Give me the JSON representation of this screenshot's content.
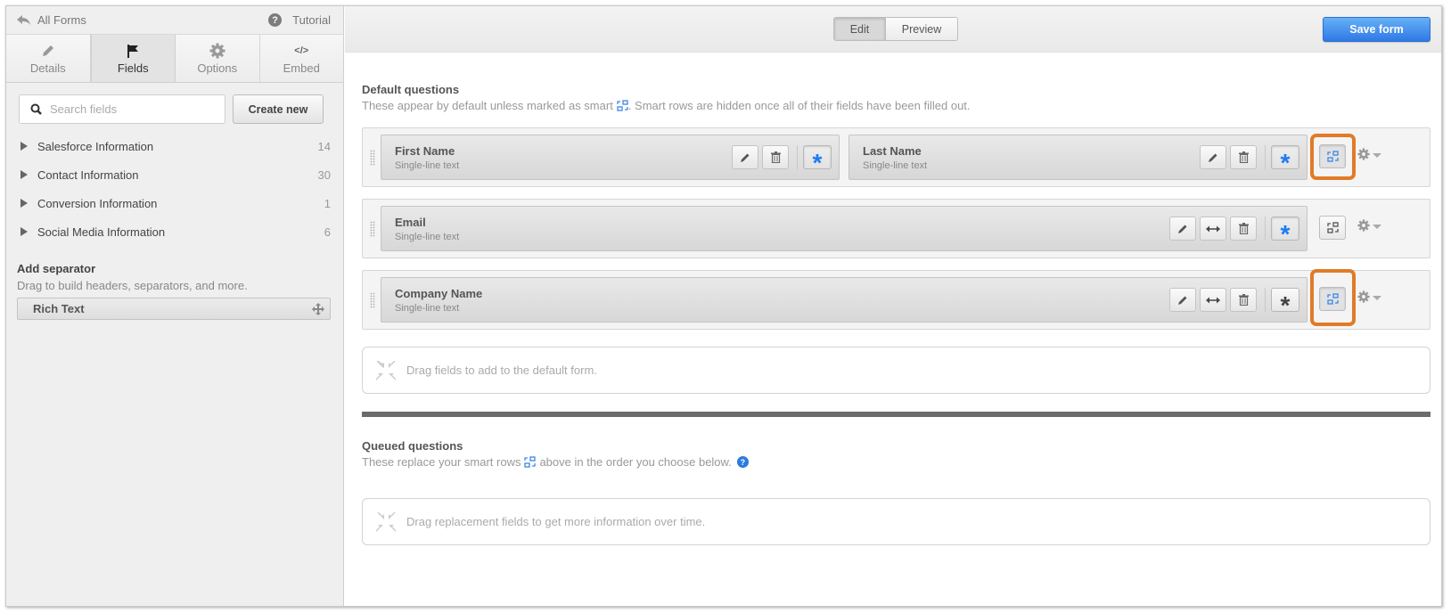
{
  "sidebar": {
    "back_label": "All Forms",
    "tutorial_label": "Tutorial",
    "tabs": [
      {
        "label": "Details",
        "icon": "pencil-icon",
        "active": false
      },
      {
        "label": "Fields",
        "icon": "flag-icon",
        "active": true
      },
      {
        "label": "Options",
        "icon": "gear-icon",
        "active": false
      },
      {
        "label": "Embed",
        "icon": "code-icon",
        "active": false
      }
    ],
    "search": {
      "placeholder": "Search fields",
      "value": ""
    },
    "create_new_label": "Create new",
    "field_groups": [
      {
        "name": "Salesforce Information",
        "count": "14"
      },
      {
        "name": "Contact Information",
        "count": "30"
      },
      {
        "name": "Conversion Information",
        "count": "1"
      },
      {
        "name": "Social Media Information",
        "count": "6"
      }
    ],
    "separator": {
      "title": "Add separator",
      "description": "Drag to build headers, separators, and more.",
      "item_label": "Rich Text"
    }
  },
  "toolbar": {
    "edit_label": "Edit",
    "preview_label": "Preview",
    "active_mode": "Edit",
    "save_label": "Save form",
    "save_color": "#2f78e6"
  },
  "default_questions": {
    "title": "Default questions",
    "desc_before": "These appear by default unless marked as smart",
    "desc_after": ". Smart rows are hidden once all of their fields have been filled out.",
    "rows": [
      {
        "fields": [
          {
            "name": "First Name",
            "type": "Single-line text",
            "required": true
          },
          {
            "name": "Last Name",
            "type": "Single-line text",
            "required": true
          }
        ],
        "smart": true,
        "highlighted": true
      },
      {
        "fields": [
          {
            "name": "Email",
            "type": "Single-line text",
            "required": true
          }
        ],
        "smart": false,
        "highlighted": false
      },
      {
        "fields": [
          {
            "name": "Company Name",
            "type": "Single-line text",
            "required": false
          }
        ],
        "smart": true,
        "highlighted": true
      }
    ],
    "dropzone_text": "Drag fields to add to the default form."
  },
  "queued_questions": {
    "title": "Queued questions",
    "desc_before": "These replace your smart rows",
    "desc_after": "above in the order you choose below.",
    "dropzone_text": "Drag replacement fields to get more information over time."
  },
  "colors": {
    "accent_blue": "#1e7bf0",
    "highlight_orange": "#e17b27",
    "divider": "#6b6b6b"
  }
}
